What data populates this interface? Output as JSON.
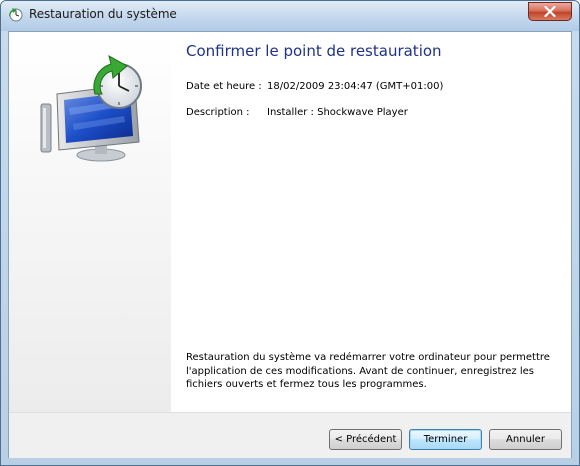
{
  "window": {
    "title": "Restauration du système"
  },
  "main": {
    "heading": "Confirmer le point de restauration",
    "date_label": "Date et heure :",
    "date_value": "18/02/2009 23:04:47 (GMT+01:00)",
    "description_label": "Description :",
    "description_value": "Installer : Shockwave Player",
    "note_line1": "Restauration du système va redémarrer votre ordinateur pour permettre",
    "note_line2": "l'application de ces modifications. Avant de continuer, enregistrez les",
    "note_line3": "fichiers ouverts et fermez tous les programmes."
  },
  "buttons": {
    "back_label": "< Précédent",
    "finish_label": "Terminer",
    "cancel_label": "Annuler"
  },
  "icons": {
    "title": "system-restore-icon",
    "hero": "system-restore-monitor-icon",
    "close": "close-icon"
  },
  "colors": {
    "heading": "#1e3287",
    "close_button": "#c2432b",
    "default_button_border": "#3c7fb1"
  }
}
